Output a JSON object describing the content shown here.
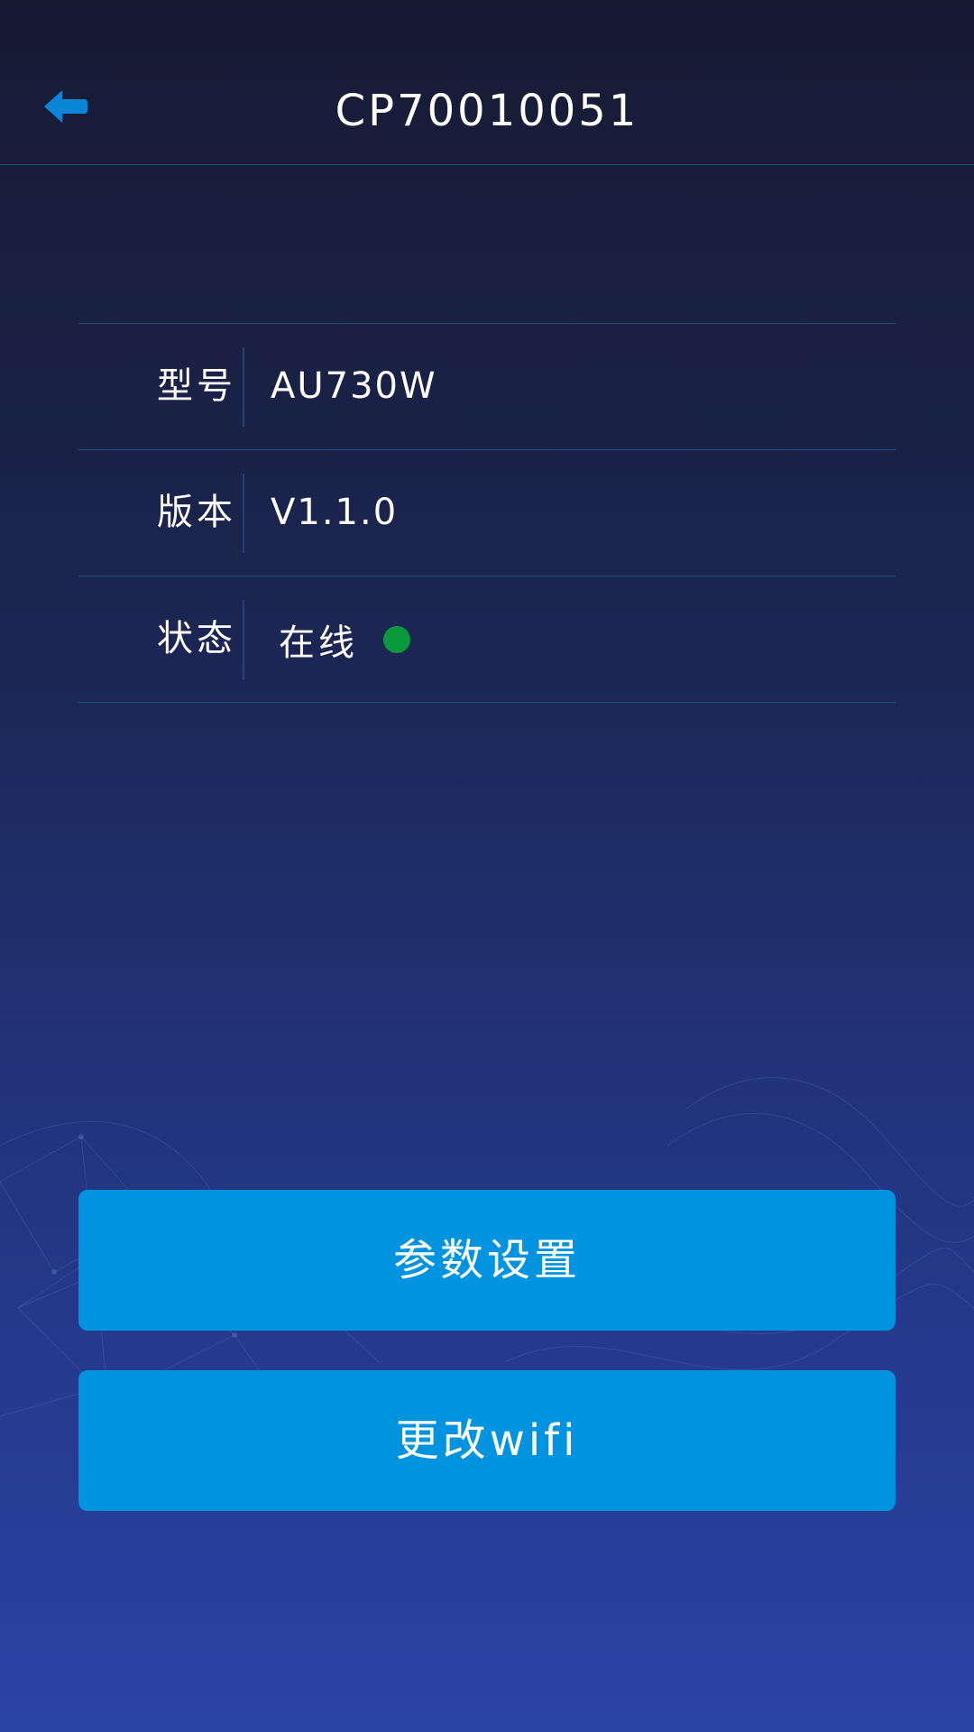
{
  "header": {
    "title": "CP70010051",
    "back_icon": "arrow-left-icon"
  },
  "info": {
    "rows": [
      {
        "label": "型号",
        "value": "AU730W"
      },
      {
        "label": "版本",
        "value": "V1.1.0"
      },
      {
        "label": "状态",
        "value": "在线"
      }
    ],
    "status_color": "#0a9a3c"
  },
  "buttons": {
    "params_label": "参数设置",
    "wifi_label": "更改wifi"
  },
  "colors": {
    "accent": "#0094e0",
    "background_top": "#161a33",
    "background_bottom": "#2a44a6"
  }
}
